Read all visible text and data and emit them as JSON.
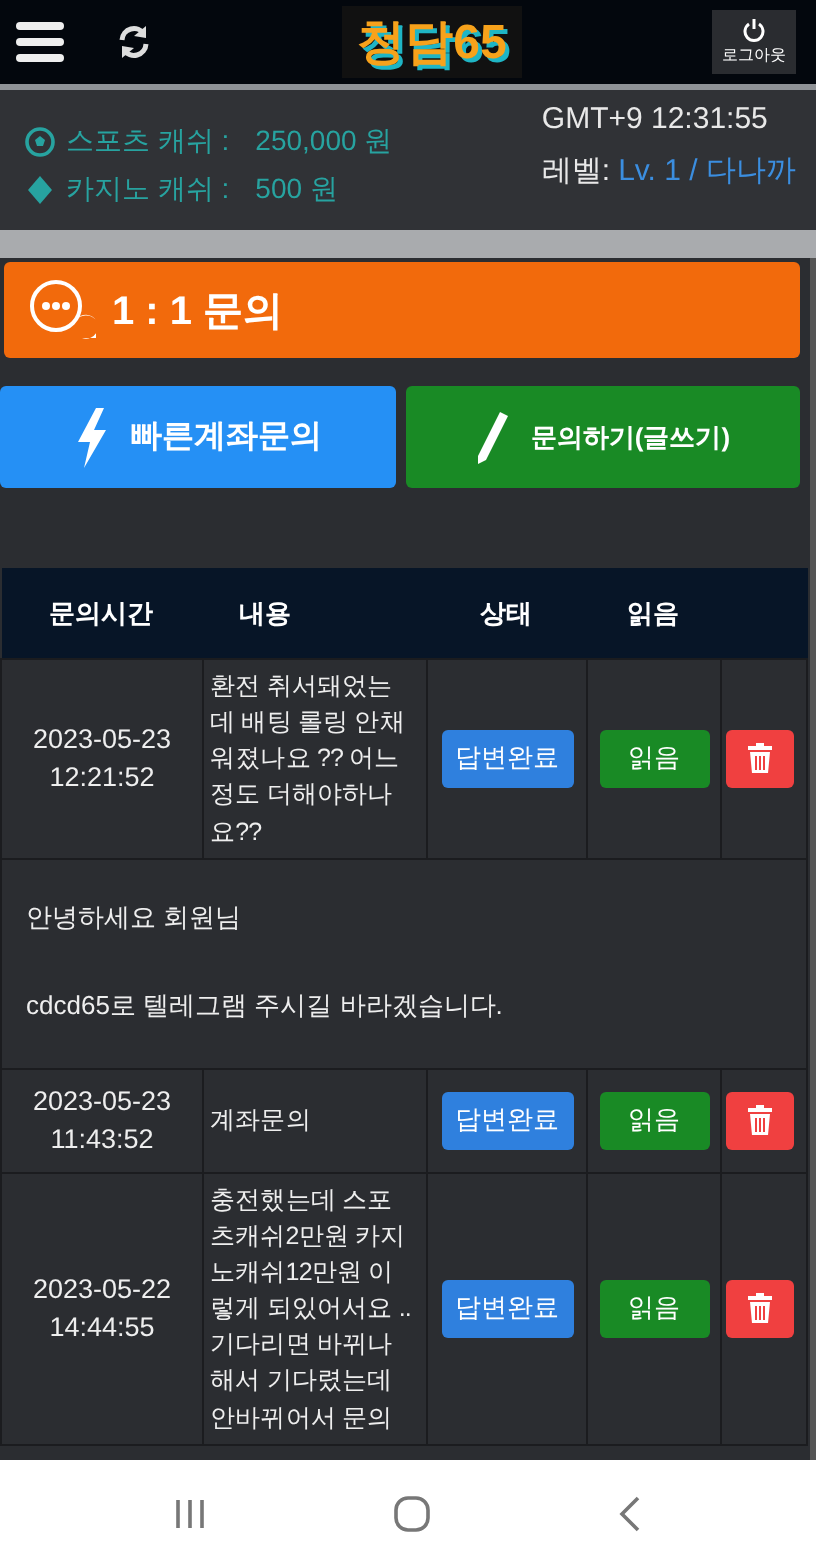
{
  "header": {
    "logo": "청담65",
    "logout_label": "로그아웃"
  },
  "wallet": [
    {
      "kind": "sports",
      "label": "스포츠 캐쉬 :",
      "amount": "250,000 원"
    },
    {
      "kind": "casino",
      "label": "카지노 캐쉬 :",
      "amount": "500 원"
    }
  ],
  "clock": "GMT+9 12:31:55",
  "level": {
    "label": "레벨:",
    "value": "Lv. 1 / 다나까"
  },
  "banner": {
    "title": "1 : 1 문의"
  },
  "actions": [
    {
      "kind": "quick",
      "label": "빠른계좌문의"
    },
    {
      "kind": "write",
      "label": "문의하기(글쓰기)"
    }
  ],
  "table": {
    "columns": [
      "문의시간",
      "내용",
      "상태",
      "읽음"
    ],
    "rows": [
      {
        "kind": "inquiry",
        "date": "2023-05-23",
        "time": "12:21:52",
        "content": [
          "환전 취서돼었는",
          "데 배팅 롤링 안채",
          "워졌나요 ?? 어느",
          "정도 더해야하나",
          "요??"
        ],
        "status": "답변완료",
        "read": "읽음"
      },
      {
        "kind": "answer",
        "lines": [
          "안녕하세요 회원님",
          "cdcd65로 텔레그램 주시길 바라겠습니다."
        ]
      },
      {
        "kind": "inquiry",
        "date": "2023-05-23",
        "time": "11:43:52",
        "content": [
          "계좌문의"
        ],
        "status": "답변완료",
        "read": "읽음"
      },
      {
        "kind": "inquiry",
        "date": "2023-05-22",
        "time": "14:44:55",
        "content": [
          "충전했는데 스포",
          "츠캐쉬2만원 카지",
          "노캐쉬12만원 이",
          "렇게 되있어서요 ..",
          "기다리면 바뀌나",
          "해서 기다렸는데",
          "안바뀌어서 문의"
        ],
        "status": "답변완료",
        "read": "읽음"
      }
    ]
  }
}
